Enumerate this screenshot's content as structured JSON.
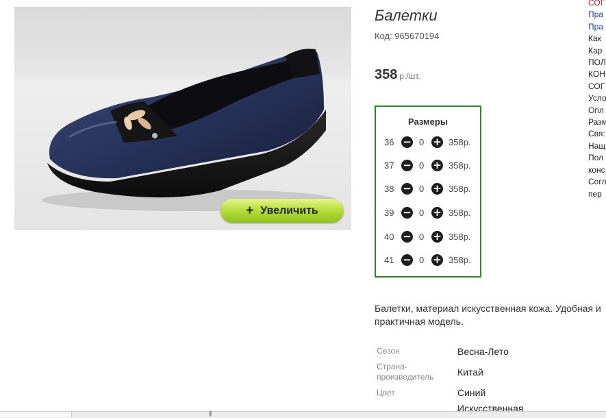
{
  "product": {
    "title": "Балетки",
    "code": "Код: 965670194",
    "price_value": "358",
    "price_unit": "р./шт.",
    "zoom_label": "Увеличить",
    "zoom_icon": "+"
  },
  "sizes": {
    "title": "Размеры",
    "rows": [
      {
        "size": "36",
        "qty": "0",
        "price": "358р."
      },
      {
        "size": "37",
        "qty": "0",
        "price": "358р."
      },
      {
        "size": "38",
        "qty": "0",
        "price": "358р."
      },
      {
        "size": "39",
        "qty": "0",
        "price": "358р."
      },
      {
        "size": "40",
        "qty": "0",
        "price": "358р."
      },
      {
        "size": "41",
        "qty": "0",
        "price": "358р."
      }
    ]
  },
  "description": "Балетки, материал искусственная кожа. Удобная и практичная модель.",
  "attributes": [
    {
      "name": "Сезон",
      "value": "Весна-Лето"
    },
    {
      "name": "Страна-производитель",
      "value": "Китай"
    },
    {
      "name": "Цвет",
      "value": "Синий"
    },
    {
      "name": "",
      "value": "Искусственная"
    }
  ],
  "side_menu": [
    {
      "text": "СОГ",
      "style": "red"
    },
    {
      "text": "Пра",
      "style": "blue"
    },
    {
      "text": "Пра",
      "style": "blue"
    },
    {
      "text": "Как",
      "style": "normal"
    },
    {
      "text": "Кар",
      "style": "normal"
    },
    {
      "text": "ПОЛ",
      "style": "normal"
    },
    {
      "text": "КОН",
      "style": "normal"
    },
    {
      "text": "СОГ",
      "style": "normal"
    },
    {
      "text": "Усло",
      "style": "normal"
    },
    {
      "text": "Опл",
      "style": "normal"
    },
    {
      "text": "Разм",
      "style": "normal"
    },
    {
      "text": "Свя:",
      "style": "normal"
    },
    {
      "text": "Нащ",
      "style": "normal"
    },
    {
      "text": "Пол",
      "style": "normal"
    },
    {
      "text": "конс",
      "style": "normal"
    },
    {
      "text": "Согл",
      "style": "normal"
    },
    {
      "text": "пер",
      "style": "normal"
    }
  ],
  "icons": {
    "minus": "minus-circle-icon",
    "plus": "plus-circle-icon"
  },
  "colors": {
    "sizes_border": "#2a8a2a",
    "zoom_button": "#b7dc3a",
    "menu_red": "#d02020",
    "menu_blue": "#1a3fb8"
  },
  "scrollbar_grip": "|||"
}
